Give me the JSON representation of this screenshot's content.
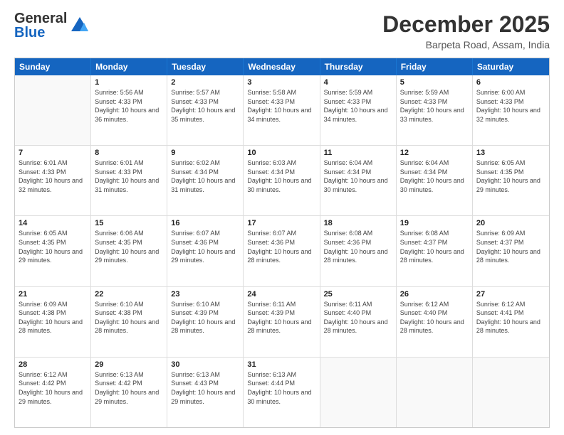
{
  "logo": {
    "line1": "General",
    "line2": "Blue"
  },
  "header": {
    "title": "December 2025",
    "location": "Barpeta Road, Assam, India"
  },
  "days_of_week": [
    "Sunday",
    "Monday",
    "Tuesday",
    "Wednesday",
    "Thursday",
    "Friday",
    "Saturday"
  ],
  "weeks": [
    [
      {
        "day": "",
        "sunrise": "",
        "sunset": "",
        "daylight": "",
        "empty": true
      },
      {
        "day": "1",
        "sunrise": "Sunrise: 5:56 AM",
        "sunset": "Sunset: 4:33 PM",
        "daylight": "Daylight: 10 hours and 36 minutes.",
        "empty": false
      },
      {
        "day": "2",
        "sunrise": "Sunrise: 5:57 AM",
        "sunset": "Sunset: 4:33 PM",
        "daylight": "Daylight: 10 hours and 35 minutes.",
        "empty": false
      },
      {
        "day": "3",
        "sunrise": "Sunrise: 5:58 AM",
        "sunset": "Sunset: 4:33 PM",
        "daylight": "Daylight: 10 hours and 34 minutes.",
        "empty": false
      },
      {
        "day": "4",
        "sunrise": "Sunrise: 5:59 AM",
        "sunset": "Sunset: 4:33 PM",
        "daylight": "Daylight: 10 hours and 34 minutes.",
        "empty": false
      },
      {
        "day": "5",
        "sunrise": "Sunrise: 5:59 AM",
        "sunset": "Sunset: 4:33 PM",
        "daylight": "Daylight: 10 hours and 33 minutes.",
        "empty": false
      },
      {
        "day": "6",
        "sunrise": "Sunrise: 6:00 AM",
        "sunset": "Sunset: 4:33 PM",
        "daylight": "Daylight: 10 hours and 32 minutes.",
        "empty": false
      }
    ],
    [
      {
        "day": "7",
        "sunrise": "Sunrise: 6:01 AM",
        "sunset": "Sunset: 4:33 PM",
        "daylight": "Daylight: 10 hours and 32 minutes.",
        "empty": false
      },
      {
        "day": "8",
        "sunrise": "Sunrise: 6:01 AM",
        "sunset": "Sunset: 4:33 PM",
        "daylight": "Daylight: 10 hours and 31 minutes.",
        "empty": false
      },
      {
        "day": "9",
        "sunrise": "Sunrise: 6:02 AM",
        "sunset": "Sunset: 4:34 PM",
        "daylight": "Daylight: 10 hours and 31 minutes.",
        "empty": false
      },
      {
        "day": "10",
        "sunrise": "Sunrise: 6:03 AM",
        "sunset": "Sunset: 4:34 PM",
        "daylight": "Daylight: 10 hours and 30 minutes.",
        "empty": false
      },
      {
        "day": "11",
        "sunrise": "Sunrise: 6:04 AM",
        "sunset": "Sunset: 4:34 PM",
        "daylight": "Daylight: 10 hours and 30 minutes.",
        "empty": false
      },
      {
        "day": "12",
        "sunrise": "Sunrise: 6:04 AM",
        "sunset": "Sunset: 4:34 PM",
        "daylight": "Daylight: 10 hours and 30 minutes.",
        "empty": false
      },
      {
        "day": "13",
        "sunrise": "Sunrise: 6:05 AM",
        "sunset": "Sunset: 4:35 PM",
        "daylight": "Daylight: 10 hours and 29 minutes.",
        "empty": false
      }
    ],
    [
      {
        "day": "14",
        "sunrise": "Sunrise: 6:05 AM",
        "sunset": "Sunset: 4:35 PM",
        "daylight": "Daylight: 10 hours and 29 minutes.",
        "empty": false
      },
      {
        "day": "15",
        "sunrise": "Sunrise: 6:06 AM",
        "sunset": "Sunset: 4:35 PM",
        "daylight": "Daylight: 10 hours and 29 minutes.",
        "empty": false
      },
      {
        "day": "16",
        "sunrise": "Sunrise: 6:07 AM",
        "sunset": "Sunset: 4:36 PM",
        "daylight": "Daylight: 10 hours and 29 minutes.",
        "empty": false
      },
      {
        "day": "17",
        "sunrise": "Sunrise: 6:07 AM",
        "sunset": "Sunset: 4:36 PM",
        "daylight": "Daylight: 10 hours and 28 minutes.",
        "empty": false
      },
      {
        "day": "18",
        "sunrise": "Sunrise: 6:08 AM",
        "sunset": "Sunset: 4:36 PM",
        "daylight": "Daylight: 10 hours and 28 minutes.",
        "empty": false
      },
      {
        "day": "19",
        "sunrise": "Sunrise: 6:08 AM",
        "sunset": "Sunset: 4:37 PM",
        "daylight": "Daylight: 10 hours and 28 minutes.",
        "empty": false
      },
      {
        "day": "20",
        "sunrise": "Sunrise: 6:09 AM",
        "sunset": "Sunset: 4:37 PM",
        "daylight": "Daylight: 10 hours and 28 minutes.",
        "empty": false
      }
    ],
    [
      {
        "day": "21",
        "sunrise": "Sunrise: 6:09 AM",
        "sunset": "Sunset: 4:38 PM",
        "daylight": "Daylight: 10 hours and 28 minutes.",
        "empty": false
      },
      {
        "day": "22",
        "sunrise": "Sunrise: 6:10 AM",
        "sunset": "Sunset: 4:38 PM",
        "daylight": "Daylight: 10 hours and 28 minutes.",
        "empty": false
      },
      {
        "day": "23",
        "sunrise": "Sunrise: 6:10 AM",
        "sunset": "Sunset: 4:39 PM",
        "daylight": "Daylight: 10 hours and 28 minutes.",
        "empty": false
      },
      {
        "day": "24",
        "sunrise": "Sunrise: 6:11 AM",
        "sunset": "Sunset: 4:39 PM",
        "daylight": "Daylight: 10 hours and 28 minutes.",
        "empty": false
      },
      {
        "day": "25",
        "sunrise": "Sunrise: 6:11 AM",
        "sunset": "Sunset: 4:40 PM",
        "daylight": "Daylight: 10 hours and 28 minutes.",
        "empty": false
      },
      {
        "day": "26",
        "sunrise": "Sunrise: 6:12 AM",
        "sunset": "Sunset: 4:40 PM",
        "daylight": "Daylight: 10 hours and 28 minutes.",
        "empty": false
      },
      {
        "day": "27",
        "sunrise": "Sunrise: 6:12 AM",
        "sunset": "Sunset: 4:41 PM",
        "daylight": "Daylight: 10 hours and 28 minutes.",
        "empty": false
      }
    ],
    [
      {
        "day": "28",
        "sunrise": "Sunrise: 6:12 AM",
        "sunset": "Sunset: 4:42 PM",
        "daylight": "Daylight: 10 hours and 29 minutes.",
        "empty": false
      },
      {
        "day": "29",
        "sunrise": "Sunrise: 6:13 AM",
        "sunset": "Sunset: 4:42 PM",
        "daylight": "Daylight: 10 hours and 29 minutes.",
        "empty": false
      },
      {
        "day": "30",
        "sunrise": "Sunrise: 6:13 AM",
        "sunset": "Sunset: 4:43 PM",
        "daylight": "Daylight: 10 hours and 29 minutes.",
        "empty": false
      },
      {
        "day": "31",
        "sunrise": "Sunrise: 6:13 AM",
        "sunset": "Sunset: 4:44 PM",
        "daylight": "Daylight: 10 hours and 30 minutes.",
        "empty": false
      },
      {
        "day": "",
        "sunrise": "",
        "sunset": "",
        "daylight": "",
        "empty": true
      },
      {
        "day": "",
        "sunrise": "",
        "sunset": "",
        "daylight": "",
        "empty": true
      },
      {
        "day": "",
        "sunrise": "",
        "sunset": "",
        "daylight": "",
        "empty": true
      }
    ]
  ]
}
